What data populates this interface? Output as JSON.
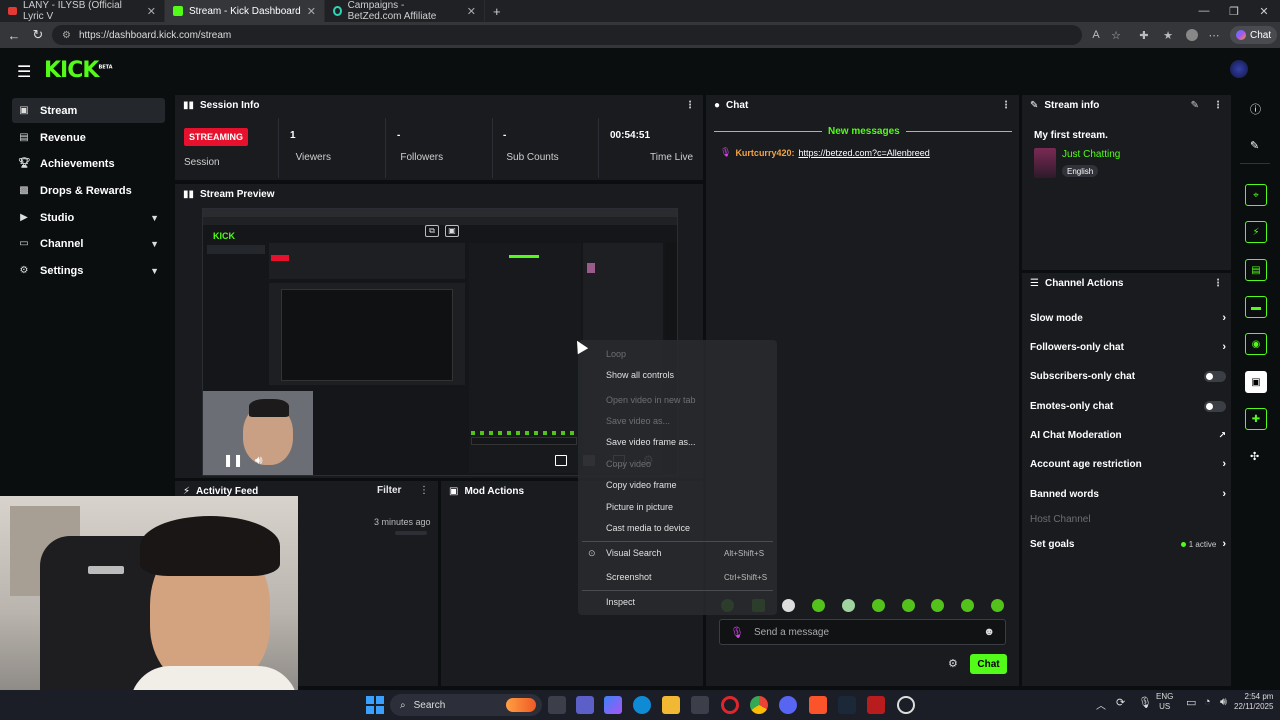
{
  "browser": {
    "tabs": [
      {
        "label": "LANY - ILYSB (Official Lyric V",
        "icon": "youtube-icon"
      },
      {
        "label": "Stream - Kick Dashboard",
        "icon": "kick-icon"
      },
      {
        "label": "Campaigns - BetZed.com Affiliate",
        "icon": "betzed-icon"
      }
    ],
    "url": "https://dashboard.kick.com/stream",
    "chat_button": "Chat"
  },
  "logo": {
    "text": "KICK",
    "badge": "BETA"
  },
  "sidebar": {
    "items": [
      {
        "label": "Stream",
        "icon": "video-icon",
        "active": true
      },
      {
        "label": "Revenue",
        "icon": "revenue-icon"
      },
      {
        "label": "Achievements",
        "icon": "trophy-icon"
      },
      {
        "label": "Drops & Rewards",
        "icon": "gift-icon"
      },
      {
        "label": "Studio",
        "icon": "studio-icon",
        "expandable": true
      },
      {
        "label": "Channel",
        "icon": "channel-icon",
        "expandable": true
      },
      {
        "label": "Settings",
        "icon": "gear-icon",
        "expandable": true
      }
    ]
  },
  "session": {
    "title": "Session Info",
    "status_badge": "STREAMING",
    "status_label": "Session",
    "viewers": "1",
    "viewers_label": "Viewers",
    "followers": "-",
    "followers_label": "Followers",
    "subs": "-",
    "subs_label": "Sub Counts",
    "time": "00:54:51",
    "time_label": "Time Live"
  },
  "preview": {
    "title": "Stream Preview"
  },
  "activity": {
    "title": "Activity Feed",
    "filter": "Filter",
    "item_time": "3 minutes ago"
  },
  "mod_actions": {
    "title": "Mod Actions"
  },
  "chat": {
    "title": "Chat",
    "new_messages": "New messages",
    "message_user": "Kurtcurry420:",
    "message_link": "https://betzed.com?c=Allenbreed",
    "input_placeholder": "Send a message",
    "send_button": "Chat"
  },
  "stream_info": {
    "title": "Stream info",
    "stream_title": "My first stream.",
    "category": "Just Chatting",
    "language": "English"
  },
  "channel_actions": {
    "title": "Channel Actions",
    "items": [
      {
        "label": "Slow mode",
        "type": "arrow"
      },
      {
        "label": "Followers-only chat",
        "type": "arrow"
      },
      {
        "label": "Subscribers-only chat",
        "type": "toggle"
      },
      {
        "label": "Emotes-only chat",
        "type": "toggle"
      },
      {
        "label": "AI Chat Moderation",
        "type": "external"
      },
      {
        "label": "Account age restriction",
        "type": "arrow"
      },
      {
        "label": "Banned words",
        "type": "arrow"
      },
      {
        "label": "Host Channel",
        "type": "disabled"
      },
      {
        "label": "Set goals",
        "type": "arrow",
        "status": "1 active"
      }
    ]
  },
  "context_menu": {
    "items": [
      {
        "label": "Loop",
        "dim": true
      },
      {
        "label": "Show all controls"
      },
      {
        "label": "Open video in new tab",
        "dim": true
      },
      {
        "label": "Save video as...",
        "dim": true
      },
      {
        "label": "Copy video",
        "dim": true
      },
      {
        "label": "Save video frame as..."
      },
      {
        "label": "Copy video frame"
      },
      {
        "label": "Picture in picture"
      },
      {
        "label": "Cast media to device"
      },
      {
        "label": "Visual Search",
        "shortcut": "Alt+Shift+S"
      },
      {
        "label": "Screenshot",
        "shortcut": "Ctrl+Shift+S"
      },
      {
        "label": "Inspect"
      }
    ]
  },
  "taskbar": {
    "search": "Search",
    "lang_top": "ENG",
    "lang_bottom": "US",
    "time": "2:54 pm",
    "date": "22/11/2025"
  },
  "colors": {
    "accent": "#53fc18",
    "streaming": "#e8112d",
    "panel": "#191b1f",
    "bg": "#0b0e0f"
  }
}
